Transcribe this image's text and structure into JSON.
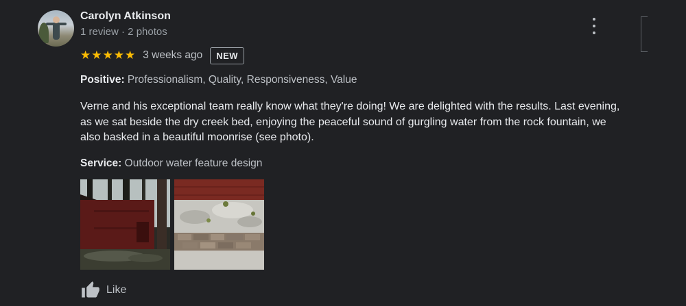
{
  "reviewer": {
    "name": "Carolyn Atkinson",
    "meta": "1 review · 2 photos"
  },
  "rating": {
    "stars": 5,
    "stars_text": "★★★★★",
    "time_ago": "3 weeks ago",
    "badge": "NEW"
  },
  "positive": {
    "label": "Positive:",
    "value": "Professionalism, Quality, Responsiveness, Value"
  },
  "review_text": "Verne and his exceptional team really know what they're doing! We are delighted with the results. Last evening, as we sat beside the dry creek bed, enjoying the peaceful sound of gurgling water from the rock fountain, we also basked in a beautiful moonrise (see photo).",
  "service": {
    "label": "Service:",
    "value": "Outdoor water feature design"
  },
  "actions": {
    "like_label": "Like"
  },
  "colors": {
    "background": "#202124",
    "star": "#fbbc04",
    "text_primary": "#e8eaed",
    "text_secondary": "#bdc1c6"
  },
  "icons": [
    "more-vert-icon",
    "star-icon",
    "thumbs-up-icon"
  ]
}
